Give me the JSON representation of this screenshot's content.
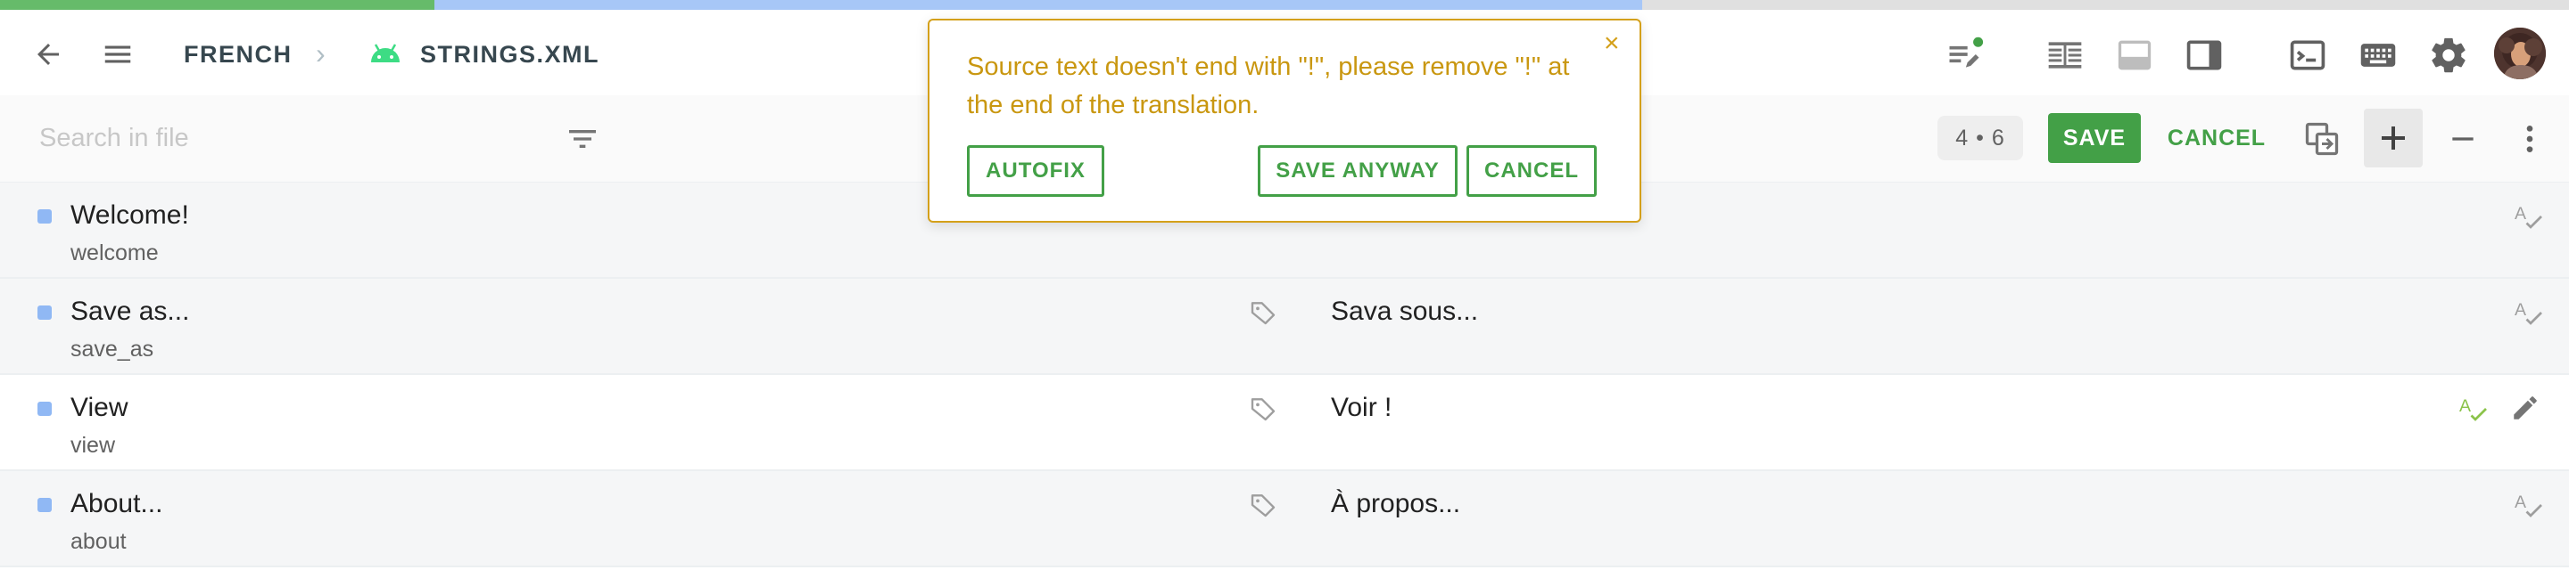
{
  "progress": {
    "translated_fraction": 0.169,
    "reviewed_fraction": 0.47
  },
  "colors": {
    "accent": "#43a047",
    "warning": "#d4a01a",
    "warning_text": "#c99710",
    "marker": "#90b8f4"
  },
  "header": {
    "breadcrumb": [
      {
        "label": "FRENCH"
      },
      {
        "label": "STRINGS.XML",
        "icon": "android-icon"
      }
    ],
    "icons": [
      "back-arrow-icon",
      "menu-icon",
      "edit-notes-icon",
      "side-by-side-layout-icon",
      "bottom-panel-layout-icon",
      "right-panel-layout-icon",
      "terminal-icon",
      "keyboard-icon",
      "gear-icon",
      "avatar"
    ]
  },
  "toolbar": {
    "search_placeholder": "Search in file",
    "counter": "4 • 6",
    "save_label": "SAVE",
    "cancel_label": "CANCEL"
  },
  "popup": {
    "message": "Source text doesn't end with \"!\", please remove \"!\" at the end of the translation.",
    "close": "×",
    "autofix_label": "AUTOFIX",
    "save_anyway_label": "SAVE ANYWAY",
    "cancel_label": "CANCEL"
  },
  "rows": [
    {
      "source": "Welcome!",
      "key": "welcome",
      "translation": ""
    },
    {
      "source": "Save as...",
      "key": "save_as",
      "translation": "Sava sous..."
    },
    {
      "source": "View",
      "key": "view",
      "translation": "Voir !"
    },
    {
      "source": "About...",
      "key": "about",
      "translation": "À propos..."
    }
  ]
}
